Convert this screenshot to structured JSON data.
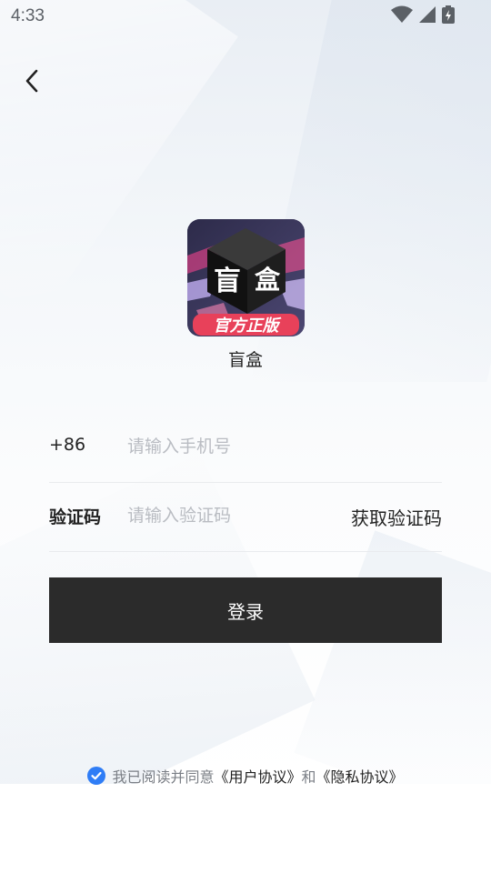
{
  "status_bar": {
    "time": "4:33"
  },
  "app": {
    "name": "盲盒",
    "logo_glyphs": {
      "char1": "盲",
      "char2": "盒",
      "banner": "官方正版"
    }
  },
  "form": {
    "phone": {
      "prefix": "+86",
      "placeholder": "请输入手机号",
      "value": ""
    },
    "code": {
      "label": "验证码",
      "placeholder": "请输入验证码",
      "value": "",
      "get_code_label": "获取验证码"
    }
  },
  "login_button": {
    "label": "登录"
  },
  "agreement": {
    "checked": true,
    "prefix": "我已阅读并同意",
    "user_agreement": "《用户协议》",
    "and": "和",
    "privacy_policy": "《隐私协议》"
  },
  "icons": {
    "back": "chevron-left-icon",
    "wifi": "wifi-icon",
    "signal": "signal-icon",
    "battery": "battery-icon",
    "check": "check-circle-icon"
  },
  "colors": {
    "button_bg": "#2b2b2b",
    "check_blue": "#2f7df6",
    "placeholder": "#b9bcc2",
    "logo_banner": "#e8415a"
  }
}
